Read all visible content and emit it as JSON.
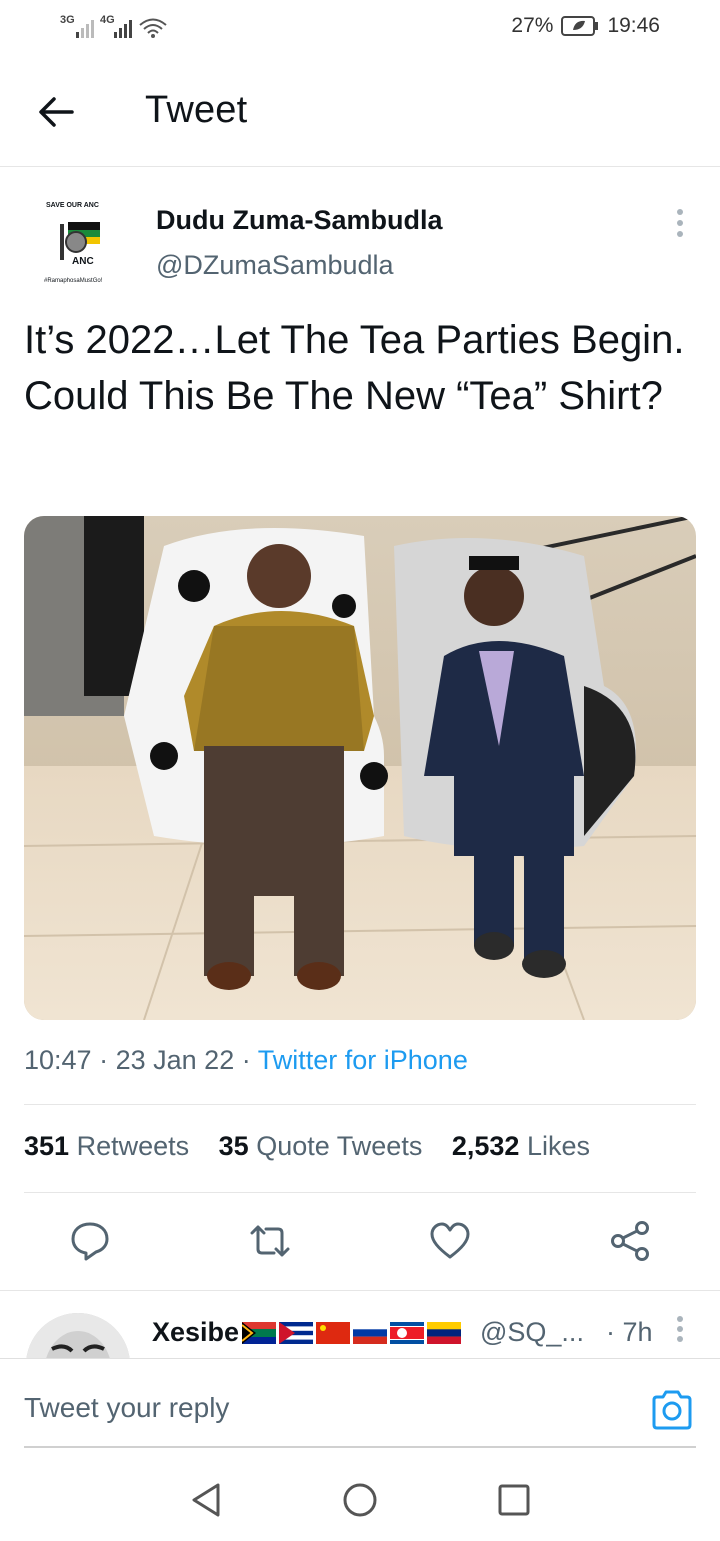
{
  "status_bar": {
    "signal_1": "3G",
    "signal_2": "4G",
    "battery": "27%",
    "time": "19:46"
  },
  "header": {
    "title": "Tweet"
  },
  "tweet": {
    "author_name": "Dudu Zuma-Sambudla",
    "author_handle": "@DZumaSambudla",
    "avatar_text_top": "SAVE OUR ANC",
    "avatar_text_logo": "ANC",
    "avatar_text_bottom": "#RamaphosaMustGo!",
    "text": "It’s 2022…Let The Tea Parties Begin. Could This Be The New “Tea” Shirt?",
    "time": "10:47",
    "date": "23 Jan 22",
    "source": "Twitter for iPhone",
    "sep": "·",
    "stats": {
      "retweets_count": "351",
      "retweets_label": "Retweets",
      "quotes_count": "35",
      "quotes_label": "Quote Tweets",
      "likes_count": "2,532",
      "likes_label": "Likes"
    }
  },
  "reply_preview": {
    "name": "Xesibe",
    "handle": "@SQ_...",
    "time": "· 7h"
  },
  "reply_composer": {
    "placeholder": "Tweet your reply"
  },
  "colors": {
    "accent": "#1d9bf0",
    "secondary_text": "#536471"
  },
  "icons": [
    "back-arrow-icon",
    "more-vertical-icon",
    "reply-icon",
    "retweet-icon",
    "like-icon",
    "share-icon",
    "camera-icon",
    "nav-back-icon",
    "nav-home-icon",
    "nav-recents-icon"
  ]
}
